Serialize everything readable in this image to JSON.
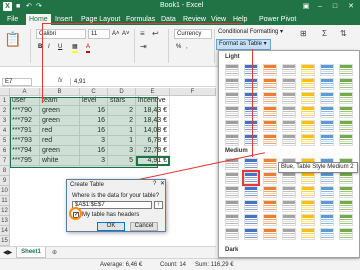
{
  "window": {
    "logo": "X",
    "title": "Book1 - Excel",
    "qa_save": "■",
    "qa_undo": "↶",
    "qa_redo": "↷",
    "ctl_restore": "▣",
    "ctl_min": "–",
    "ctl_max": "□",
    "ctl_close": "✕"
  },
  "ribbon_tabs": [
    "File",
    "Home",
    "Insert",
    "Page Layout",
    "Formulas",
    "Data",
    "Review",
    "View",
    "Help",
    "Power Pivot"
  ],
  "ribbon": {
    "font_name": "Calibri",
    "font_size": "11",
    "number_format": "Currency",
    "conditional_formatting": "Conditional Formatting ▾",
    "format_as_table": "Format as Table ▾",
    "bold": "B",
    "italic": "I",
    "underline": "U",
    "percent": "%",
    "comma": ",",
    "font_grow": "A˄",
    "font_shrink": "A˅",
    "align": "≡"
  },
  "formula_bar": {
    "name_box": "E7",
    "fx": "fx",
    "value": "4,91"
  },
  "grid": {
    "columns": [
      "A",
      "B",
      "C",
      "D",
      "E",
      "F"
    ],
    "rows": [
      "1",
      "2",
      "3",
      "4",
      "5",
      "6",
      "7",
      "8",
      "9",
      "10",
      "11",
      "12",
      "13",
      "14",
      "15"
    ],
    "headers": [
      "user",
      "team",
      "level",
      "stars",
      "incentive"
    ],
    "data": [
      [
        "***790",
        "green",
        "16",
        "2",
        "18,43 €"
      ],
      [
        "***792",
        "green",
        "16",
        "2",
        "18,43 €"
      ],
      [
        "***791",
        "red",
        "16",
        "1",
        "14,08 €"
      ],
      [
        "***793",
        "red",
        "3",
        "1",
        "6,78 €"
      ],
      [
        "***794",
        "green",
        "16",
        "3",
        "22,78 €"
      ],
      [
        "***795",
        "white",
        "3",
        "5",
        "4,91 €"
      ]
    ]
  },
  "gallery": {
    "sections": [
      "Light",
      "Medium",
      "Dark"
    ],
    "tooltip": "Blue, Table Style Medium 2"
  },
  "dialog": {
    "title": "Create Table",
    "help": "?",
    "close": "✕",
    "question": "Where is the data for your table?",
    "range": "$A$1:$E$7",
    "picker": "↑",
    "check_mark": "✓",
    "checkbox_label": "My table has headers",
    "ok": "OK",
    "cancel": "Cancel"
  },
  "sheet": {
    "tab": "Sheet1",
    "add": "⊕"
  },
  "status": {
    "average": "Average: 6,46 €",
    "count": "Count: 14",
    "sum": "Sum: 116,29 €"
  },
  "colors": {
    "excel_green": "#217346",
    "guide_red": "#e53935",
    "highlight_orange": "#ff8c00",
    "accent_blue": "#4472c4"
  }
}
